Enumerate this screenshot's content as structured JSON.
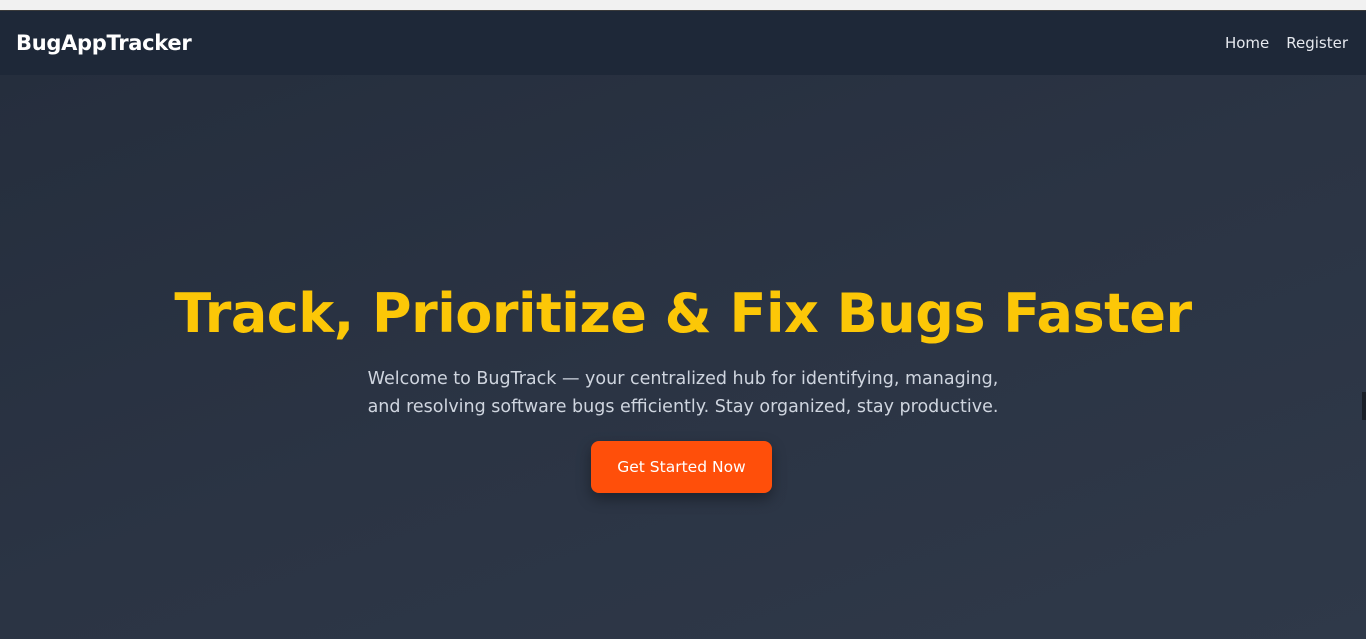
{
  "nav": {
    "brand": "BugAppTracker",
    "links": [
      "Home",
      "Register"
    ]
  },
  "hero": {
    "title": "Track, Prioritize & Fix Bugs Faster",
    "subtitle_line1": "Welcome to BugTrack — your centralized hub for identifying, managing,",
    "subtitle_line2": "and resolving software bugs efficiently. Stay organized, stay productive.",
    "cta_label": "Get Started Now"
  },
  "colors": {
    "background": "#2a3342",
    "navbar": "#1e2838",
    "title": "#fcc707",
    "cta": "#ff4f0a",
    "subtitle": "#cfd5df"
  }
}
